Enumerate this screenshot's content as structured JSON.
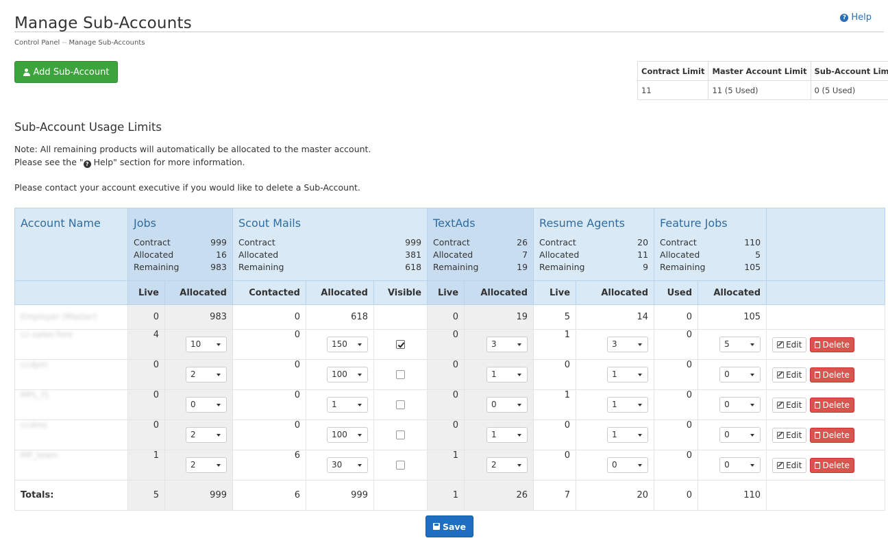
{
  "page": {
    "title": "Manage Sub-Accounts",
    "help_label": "Help",
    "breadcrumb": [
      "Control Panel",
      "Manage Sub-Accounts"
    ],
    "breadcrumb_sep": "--"
  },
  "add_button": {
    "label": "Add Sub-Account"
  },
  "limits": {
    "headers": [
      "Contract Limit",
      "Master Account Limit",
      "Sub-Account Limit"
    ],
    "values": [
      "11",
      "11 (5 Used)",
      "0 (5 Used)"
    ]
  },
  "section": {
    "title": "Sub-Account Usage Limits",
    "note1": "Note: All remaining products will automatically be allocated to the master account.",
    "note2_prefix": "Please see the \"",
    "note2_help": "Help",
    "note2_suffix": "\" section for more information.",
    "note3": "Please contact your account executive if you would like to delete a Sub-Account."
  },
  "table": {
    "account_name_header": "Account Name",
    "stat_labels": [
      "Contract",
      "Allocated",
      "Remaining"
    ],
    "groups": {
      "jobs": {
        "title": "Jobs",
        "stats": [
          "999",
          "16",
          "983"
        ]
      },
      "scout": {
        "title": "Scout Mails",
        "stats": [
          "999",
          "381",
          "618"
        ]
      },
      "textads": {
        "title": "TextAds",
        "stats": [
          "26",
          "7",
          "19"
        ]
      },
      "resume": {
        "title": "Resume Agents",
        "stats": [
          "20",
          "11",
          "9"
        ]
      },
      "feature": {
        "title": "Feature Jobs",
        "stats": [
          "110",
          "5",
          "105"
        ]
      }
    },
    "sub_headers": {
      "live": "Live",
      "allocated": "Allocated",
      "contacted": "Contacted",
      "visible": "Visible",
      "used": "Used"
    },
    "master": {
      "name": "Employer (Master)",
      "jobs_live": "0",
      "jobs_alloc": "983",
      "scout_contacted": "0",
      "scout_alloc": "618",
      "text_live": "0",
      "text_alloc": "19",
      "resume_live": "5",
      "resume_alloc": "14",
      "feature_used": "0",
      "feature_alloc": "105"
    },
    "rows": [
      {
        "name": "cc-sales-fore",
        "jobs_live": "4",
        "jobs_alloc": "10",
        "scout_contacted": "0",
        "scout_alloc": "150",
        "text_live": "0",
        "text_alloc": "3",
        "resume_live": "1",
        "resume_alloc": "3",
        "feature_used": "0",
        "feature_alloc": "5"
      },
      {
        "name": "ccdpm",
        "jobs_live": "0",
        "jobs_alloc": "2",
        "scout_contacted": "0",
        "scout_alloc": "100",
        "text_live": "0",
        "text_alloc": "1",
        "resume_live": "0",
        "resume_alloc": "1",
        "feature_used": "0",
        "feature_alloc": "0"
      },
      {
        "name": "MPL_FJ",
        "jobs_live": "0",
        "jobs_alloc": "0",
        "scout_contacted": "0",
        "scout_alloc": "1",
        "text_live": "0",
        "text_alloc": "0",
        "resume_live": "1",
        "resume_alloc": "1",
        "feature_used": "0",
        "feature_alloc": "0"
      },
      {
        "name": "ccdms",
        "jobs_live": "0",
        "jobs_alloc": "2",
        "scout_contacted": "0",
        "scout_alloc": "100",
        "text_live": "0",
        "text_alloc": "1",
        "resume_live": "0",
        "resume_alloc": "1",
        "feature_used": "0",
        "feature_alloc": "0"
      },
      {
        "name": "MP_team",
        "jobs_live": "1",
        "jobs_alloc": "2",
        "scout_contacted": "6",
        "scout_alloc": "30",
        "text_live": "1",
        "text_alloc": "2",
        "resume_live": "0",
        "resume_alloc": "0",
        "feature_used": "0",
        "feature_alloc": "0"
      }
    ],
    "visible_checked": [
      true,
      false,
      false,
      false,
      false
    ],
    "edit_label": "Edit",
    "delete_label": "Delete",
    "totals": {
      "label": "Totals:",
      "jobs_live": "5",
      "jobs_alloc": "999",
      "scout_contacted": "6",
      "scout_alloc": "999",
      "text_live": "1",
      "text_alloc": "26",
      "resume_live": "7",
      "resume_alloc": "20",
      "feature_used": "0",
      "feature_alloc": "110"
    }
  },
  "save_button": {
    "label": "Save"
  }
}
